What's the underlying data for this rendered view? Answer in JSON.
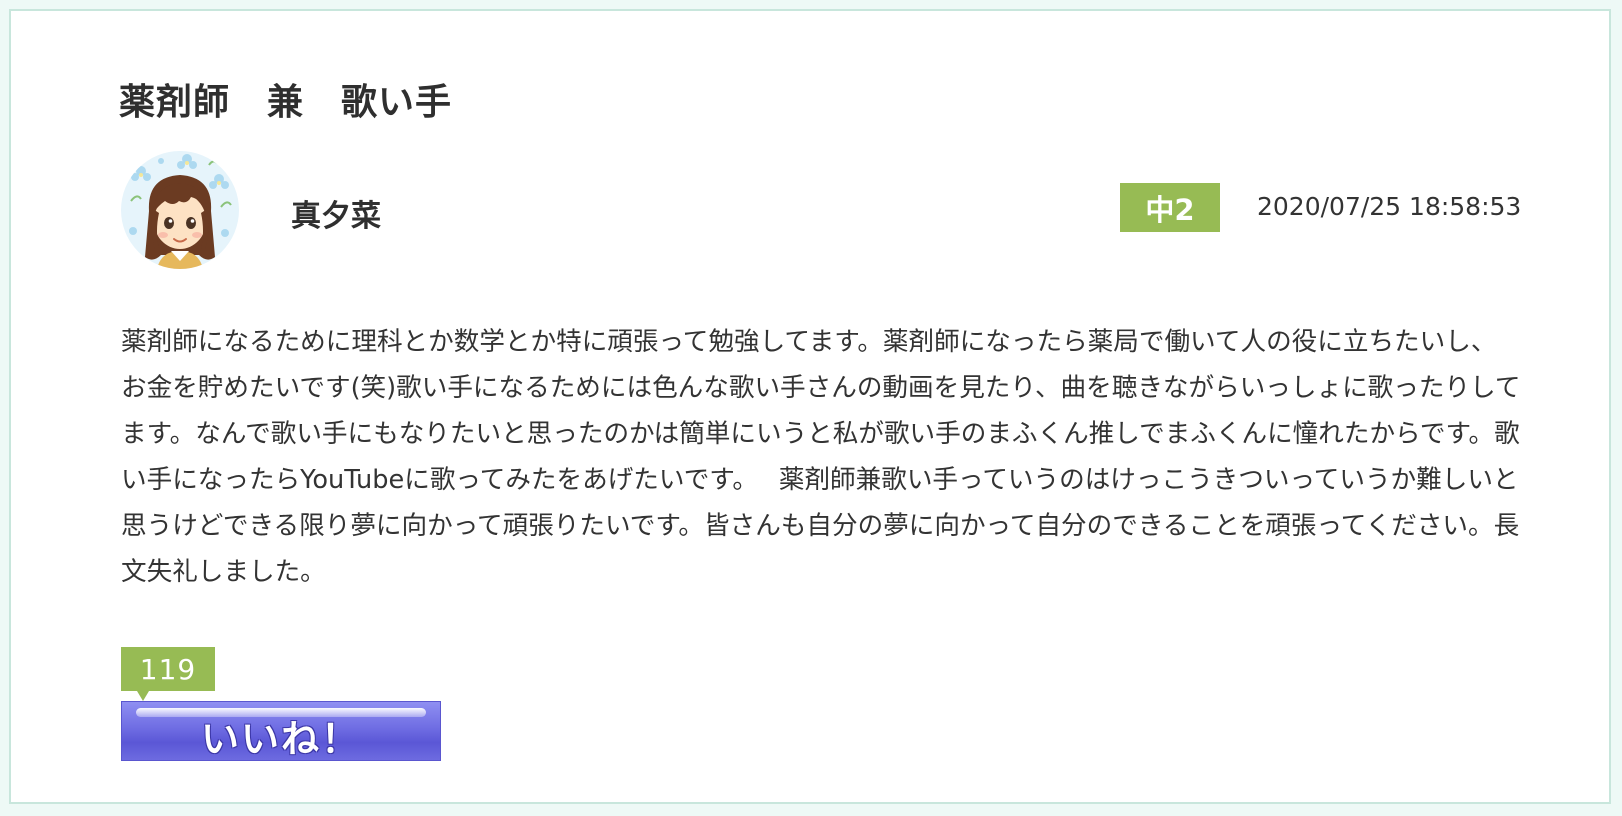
{
  "post": {
    "title": "薬剤師　兼　歌い手",
    "author": {
      "name": "真夕菜",
      "avatar_icon": "girl-avatar-icon"
    },
    "grade": "中2",
    "date": "2020/07/25 18:58:53",
    "body": "薬剤師になるために理科とか数学とか特に頑張って勉強してます。薬剤師になったら薬局で働いて人の役に立ちたいし、お金を貯めたいです(笑)歌い手になるためには色んな歌い手さんの動画を見たり、曲を聴きながらいっしょに歌ったりしてます。なんで歌い手にもなりたいと思ったのかは簡単にいうと私が歌い手のまふくん推しでまふくんに憧れたからです。歌い手になったらYouTubeに歌ってみたをあげたいです。　 薬剤師兼歌い手っていうのはけっこうきついっていうか難しいと思うけどできる限り夢に向かって頑張りたいです。皆さんも自分の夢に向かって自分のできることを頑張ってください。長文失礼しました。"
  },
  "like": {
    "count": "119",
    "button_label": "いいね！"
  },
  "colors": {
    "badge_green": "#97bb54",
    "like_button_blue": "#6f6de3",
    "card_border": "#c8e6dc",
    "page_background": "#eef9f6"
  }
}
